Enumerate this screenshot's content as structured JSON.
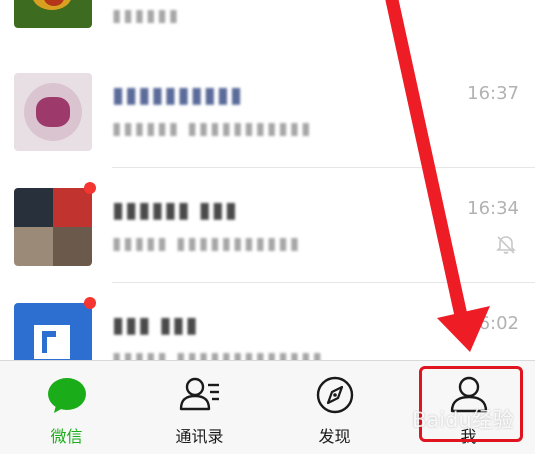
{
  "chats": [
    {
      "name": "",
      "preview": "▮▮▮▮▮▮",
      "time": "",
      "avatar_colors": [
        "#3d6b1f",
        "#d8a020",
        "#b3361a"
      ],
      "badge": false,
      "muted": false
    },
    {
      "name": "▮▮▮▮▮▮▮▮▮▮",
      "preview": "▮▮▮▮▮▮  ▮▮▮▮▮▮▮▮▮▮▮",
      "time": "16:37",
      "avatar_colors": [
        "#d9c4d0",
        "#9e3a6b",
        "#e8dfe4"
      ],
      "badge": false,
      "muted": false
    },
    {
      "name": "▮▮▮▮▮▮  ▮▮▮",
      "preview": "▮▮▮▮▮  ▮▮▮▮▮▮▮▮▮▮▮",
      "time": "16:34",
      "avatar_colors": [
        "#27303b",
        "#c0332e",
        "#9b8a78"
      ],
      "badge": true,
      "muted": true
    },
    {
      "name": "▮▮▮ ▮▮▮",
      "preview": "▮▮▮▮▮ ▮▮▮▮▮▮▮▮▮▮▮▮▮",
      "time": "6:02",
      "avatar_colors": [
        "#2d6fd0",
        "#ffffff",
        "#2d6fd0"
      ],
      "badge": true,
      "muted": false
    }
  ],
  "tabs": [
    {
      "label": "微信",
      "icon": "chat-bubble-icon",
      "active": true
    },
    {
      "label": "通讯录",
      "icon": "contacts-icon",
      "active": false
    },
    {
      "label": "发现",
      "icon": "compass-icon",
      "active": false
    },
    {
      "label": "我",
      "icon": "person-icon",
      "active": false
    }
  ],
  "colors": {
    "accent": "#1aad19",
    "annotation_red": "#e0141e",
    "badge_red": "#f43530",
    "tabbar_bg": "#f7f7f7"
  },
  "watermark": "Baidu经验"
}
